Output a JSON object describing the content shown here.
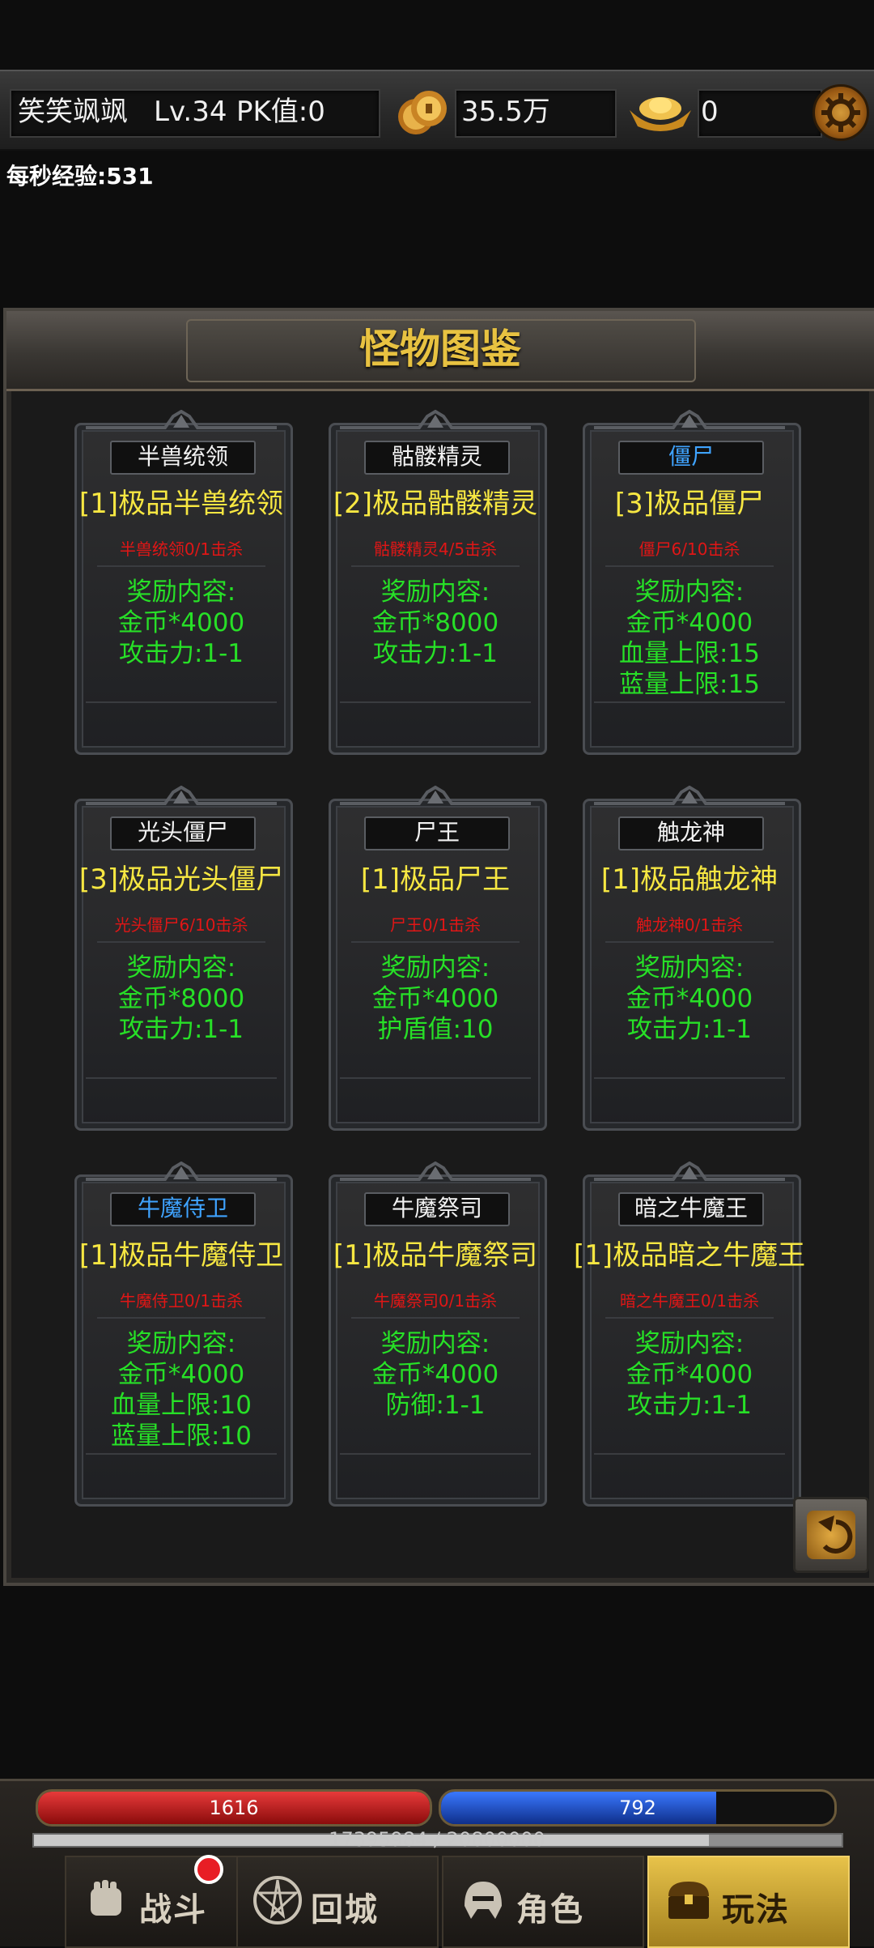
{
  "header": {
    "player": "笑笑飒飒",
    "level": "Lv.34",
    "pk": "PK值:0",
    "gold": "35.5万",
    "ingots": "0",
    "exp_per_sec": "每秒经验:531"
  },
  "panel": {
    "title": "怪物图鉴",
    "cards": [
      {
        "name": "半兽统领",
        "name_color": "white",
        "title": "[1]极品半兽统领",
        "kill": "半兽统领0/1击杀",
        "rewards": [
          "奖励内容:",
          "金币*4000",
          "攻击力:1-1"
        ]
      },
      {
        "name": "骷髅精灵",
        "name_color": "white",
        "title": "[2]极品骷髅精灵",
        "kill": "骷髅精灵4/5击杀",
        "rewards": [
          "奖励内容:",
          "金币*8000",
          "攻击力:1-1"
        ]
      },
      {
        "name": "僵尸",
        "name_color": "blue",
        "title": "[3]极品僵尸",
        "kill": "僵尸6/10击杀",
        "rewards": [
          "奖励内容:",
          "金币*4000",
          "血量上限:15",
          "蓝量上限:15"
        ]
      },
      {
        "name": "光头僵尸",
        "name_color": "white",
        "title": "[3]极品光头僵尸",
        "kill": "光头僵尸6/10击杀",
        "rewards": [
          "奖励内容:",
          "金币*8000",
          "攻击力:1-1"
        ]
      },
      {
        "name": "尸王",
        "name_color": "white",
        "title": "[1]极品尸王",
        "kill": "尸王0/1击杀",
        "rewards": [
          "奖励内容:",
          "金币*4000",
          "护盾值:10"
        ]
      },
      {
        "name": "触龙神",
        "name_color": "white",
        "title": "[1]极品触龙神",
        "kill": "触龙神0/1击杀",
        "rewards": [
          "奖励内容:",
          "金币*4000",
          "攻击力:1-1"
        ]
      },
      {
        "name": "牛魔侍卫",
        "name_color": "blue",
        "title": "[1]极品牛魔侍卫",
        "kill": "牛魔侍卫0/1击杀",
        "rewards": [
          "奖励内容:",
          "金币*4000",
          "血量上限:10",
          "蓝量上限:10"
        ]
      },
      {
        "name": "牛魔祭司",
        "name_color": "white",
        "title": "[1]极品牛魔祭司",
        "kill": "牛魔祭司0/1击杀",
        "rewards": [
          "奖励内容:",
          "金币*4000",
          "防御:1-1"
        ]
      },
      {
        "name": "暗之牛魔王",
        "name_color": "white",
        "title": "[1]极品暗之牛魔王",
        "kill": "暗之牛魔王0/1击杀",
        "rewards": [
          "奖励内容:",
          "金币*4000",
          "攻击力:1-1"
        ]
      }
    ]
  },
  "hud": {
    "hp": "1616",
    "mp": "792",
    "hp_fill": 1.0,
    "mp_fill": 0.7,
    "exp": "17395984 / 20800000",
    "exp_fill": 0.836,
    "tabs": [
      {
        "label": "战斗",
        "icon": "fist-icon"
      },
      {
        "label": "回城",
        "icon": "pentagram-icon"
      },
      {
        "label": "角色",
        "icon": "helmet-icon"
      },
      {
        "label": "玩法",
        "icon": "treasure-chest-icon"
      }
    ],
    "colors": {
      "hp": "#c01414",
      "mp": "#1a4fc4",
      "accent": "#e8c241"
    }
  }
}
